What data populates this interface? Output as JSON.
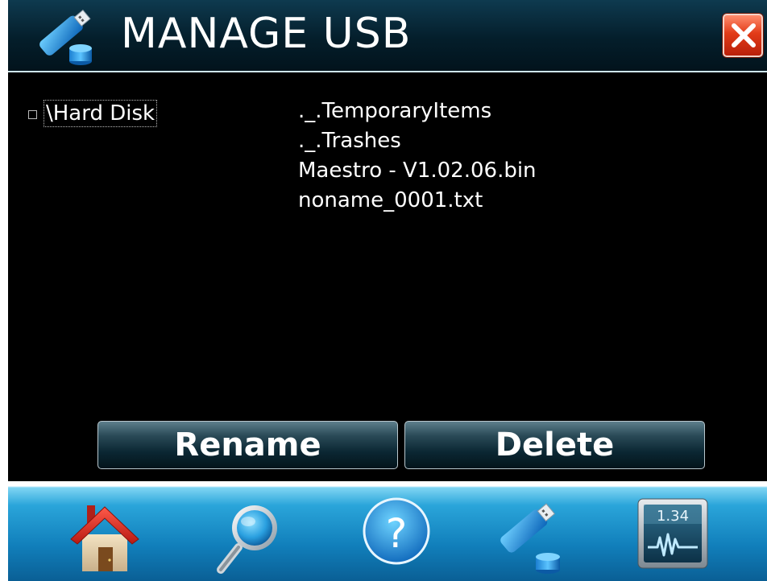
{
  "header": {
    "title": "MANAGE USB",
    "icon": "usb-drive-icon",
    "close_icon": "close-icon"
  },
  "tree": {
    "label": "\\Hard Disk"
  },
  "files": [
    "._.TemporaryItems",
    "._.Trashes",
    "Maestro - V1.02.06.bin",
    "noname_0001.txt"
  ],
  "buttons": {
    "rename": "Rename",
    "delete": "Delete"
  },
  "nav": {
    "home_icon": "home-icon",
    "search_icon": "magnifier-icon",
    "help_icon": "help-icon",
    "usb_icon": "usb-drive-icon",
    "monitor_icon": "monitor-icon",
    "monitor_value": "1.34"
  },
  "colors": {
    "header_bg": "#041e2b",
    "close_red": "#e23b18",
    "nav_blue": "#117fbb"
  }
}
